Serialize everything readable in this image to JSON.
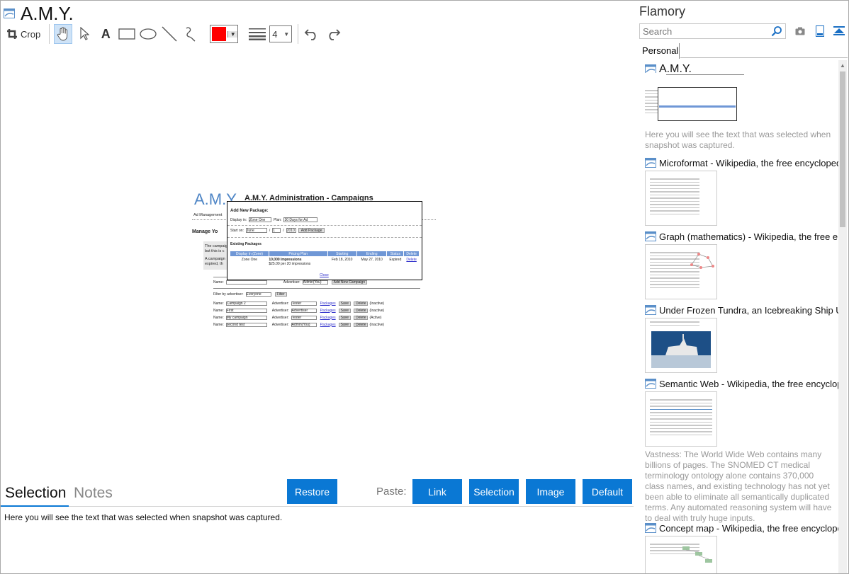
{
  "editor": {
    "title": "A.M.Y.",
    "toolbar": {
      "crop_label": "Crop",
      "line_width": "4",
      "color": "#ff0000"
    },
    "snapshot": {
      "logo": "A.M.Y.",
      "heading": "A.M.Y. Administration - Campaigns",
      "subnav": "Ad Management",
      "manage": "Manage Yo",
      "body1": "The campaig",
      "body2": "but this is c",
      "body3": "A campaign",
      "body4": "expired, th",
      "dialog": {
        "title": "Add New Package:",
        "display_in_label": "Display in:",
        "display_in_value": "Zone One",
        "plan_label": "Plan:",
        "plan_value": "30 Days for Ad",
        "start_label": "Start on:",
        "start_month": "June",
        "start_day": "1",
        "start_year": "2010",
        "add_btn": "Add Package",
        "existing": "Existing Packages",
        "cols": [
          "Display In (Zone)",
          "Pricing Plan",
          "Starting",
          "Ending",
          "Status",
          "Delete"
        ],
        "row": {
          "zone": "Zone One",
          "plan_bold": "10,000 Impressions",
          "plan_rest": "$25.00 per 20 impressions",
          "start": "Feb 18, 2010",
          "end": "May 27, 2010",
          "status": "Expired",
          "delete": "Delete"
        },
        "close": "Close"
      },
      "name_row": {
        "name": "Name:",
        "adv": "Advertiser:",
        "adv_val": "Admin(You)",
        "btn": "Add New Campaign"
      },
      "filter": {
        "label": "Filter by advertiser:",
        "value": "Everyone",
        "btn": "Filter"
      },
      "campaigns": [
        {
          "name": "Campaign 2",
          "advertiser": "Tester",
          "status": "(Inactive)"
        },
        {
          "name": "First",
          "advertiser": "Advertiser",
          "status": "(Inactive)"
        },
        {
          "name": "My campaign",
          "advertiser": "Tester",
          "status": "(Active)"
        },
        {
          "name": "second test",
          "advertiser": "Admin(You)",
          "status": "(Inactive)"
        }
      ],
      "packages_link": "Packages",
      "save_btn": "Save",
      "delete_btn": "Delete"
    },
    "tabs": {
      "selection": "Selection",
      "notes": "Notes"
    },
    "buttons": {
      "restore": "Restore",
      "paste_label": "Paste:",
      "link": "Link",
      "selection": "Selection",
      "image": "Image",
      "default": "Default"
    },
    "selection_text": "Here you will see the text that was selected when snapshot was captured."
  },
  "panel": {
    "title": "Flamory",
    "search_placeholder": "Search",
    "tab": "Personal",
    "entries": [
      {
        "title": "A.M.Y.",
        "desc": "Here you will see the text that was selected when snapshot was captured."
      },
      {
        "title": "Microformat - Wikipedia, the free encyclopedia",
        "desc": ""
      },
      {
        "title": "Graph (mathematics) - Wikipedia, the free ency",
        "desc": ""
      },
      {
        "title": "Under Frozen Tundra, an Icebreaking Ship Unco",
        "desc": ""
      },
      {
        "title": "Semantic Web - Wikipedia, the free encycloped",
        "desc": "Vastness: The World Wide Web contains many billions of pages. The SNOMED CT medical terminology ontology alone contains 370,000 class names, and existing technology has not yet been able to eliminate all semantically duplicated terms. Any automated reasoning system will have to deal with truly huge inputs."
      },
      {
        "title": "Concept map - Wikipedia, the free encyclopedia",
        "desc": ""
      }
    ]
  }
}
